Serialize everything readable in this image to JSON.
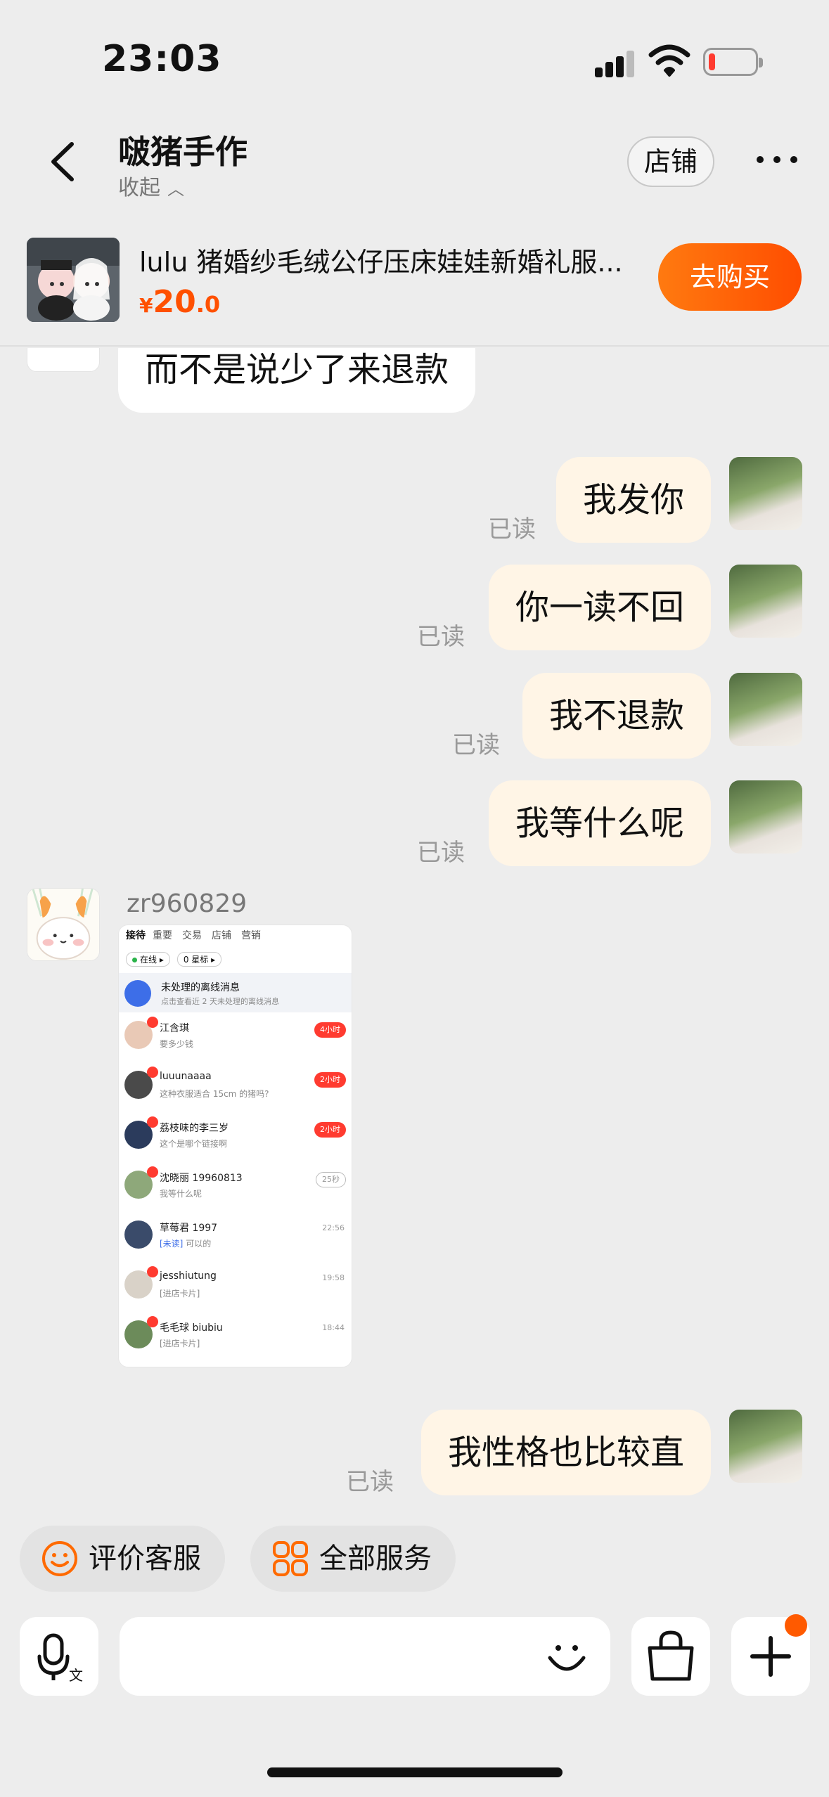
{
  "status_bar": {
    "time": "23:03"
  },
  "header": {
    "title": "啵猪手作",
    "collapse_label": "收起",
    "store_label": "店铺"
  },
  "product": {
    "title": "lulu 猪婚纱毛绒公仔压床娃娃新婚礼服...",
    "price_currency": "¥",
    "price_int": "20",
    "price_dec": ".0",
    "buy_label": "去购买"
  },
  "messages": [
    {
      "side": "left",
      "text": "而不是说少了来退款"
    },
    {
      "side": "right",
      "text": "我发你",
      "status": "已读"
    },
    {
      "side": "right",
      "text": "你一读不回",
      "status": "已读"
    },
    {
      "side": "right",
      "text": "我不退款",
      "status": "已读"
    },
    {
      "side": "right",
      "text": "我等什么呢",
      "status": "已读"
    },
    {
      "side": "left",
      "sender": "zr960829",
      "type": "image"
    },
    {
      "side": "right",
      "text": "我性格也比较直",
      "status": "已读"
    }
  ],
  "screenshot_image": {
    "tabs": [
      "接待",
      "重要",
      "交易",
      "店铺",
      "营销"
    ],
    "filters": [
      "在线",
      "0 星标"
    ],
    "notice_title": "未处理的离线消息",
    "notice_sub": "点击查看近 2 天未处理的离线消息",
    "rows": [
      {
        "name": "江含琪",
        "msg": "要多少钱",
        "tag": "4小时",
        "tag_style": "red"
      },
      {
        "name": "luuunaaaa",
        "msg": "这种衣服适合 15cm 的猪吗?",
        "tag": "2小时",
        "tag_style": "red"
      },
      {
        "name": "荔枝味的李三岁",
        "msg": "这个是哪个链接啊",
        "tag": "2小时",
        "tag_style": "red"
      },
      {
        "name": "沈晓丽 19960813",
        "msg": "我等什么呢",
        "tag": "25秒",
        "tag_style": "grey"
      },
      {
        "name": "草莓君 1997",
        "msg_prefix": "[未读]",
        "msg": "可以的",
        "time": "22:56"
      },
      {
        "name": "jesshiutung",
        "msg": "[进店卡片]",
        "time": "19:58"
      },
      {
        "name": "毛毛球 biubiu",
        "msg": "[进店卡片]",
        "time": "18:44"
      }
    ]
  },
  "services": {
    "rate_label": "评价客服",
    "all_label": "全部服务"
  },
  "input": {
    "placeholder": ""
  },
  "colors": {
    "accent": "#ff5000",
    "bubble_right": "#fff5e6",
    "bubble_left": "#ffffff",
    "background": "#ededed"
  }
}
